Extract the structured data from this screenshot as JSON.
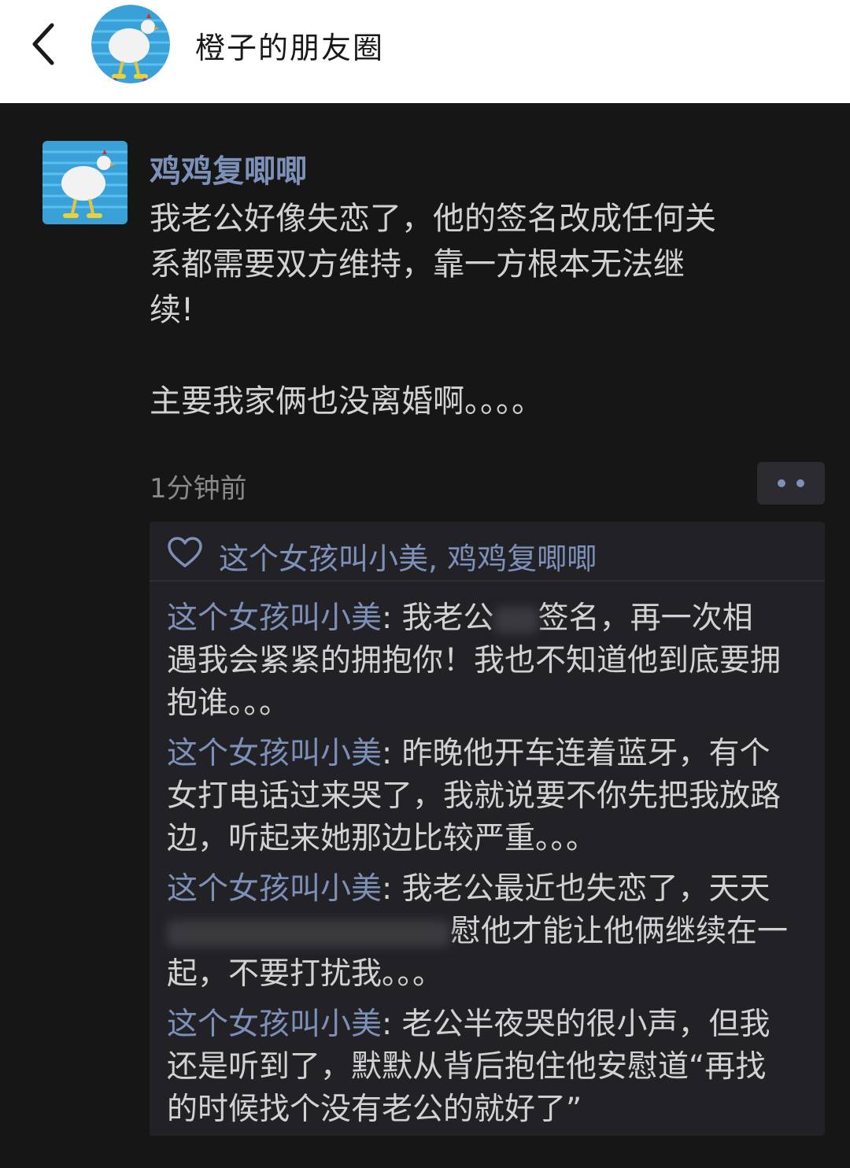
{
  "header": {
    "back_icon": "chevron-left-icon",
    "title": "橙子的朋友圈"
  },
  "post": {
    "author": "鸡鸡复唧唧",
    "text_lines": [
      "我老公好像失恋了，他的签名改成任何关",
      "系都需要双方维持，靠一方根本无法继",
      "续!",
      "主要我家俩也没离婚啊。。。。"
    ],
    "time": "1分钟前",
    "more_icon": "more-dots-icon"
  },
  "likes": {
    "heart_icon": "heart-outline-icon",
    "names": "这个女孩叫小美, 鸡鸡复唧唧"
  },
  "comments": [
    {
      "name": "这个女孩叫小美",
      "first": ": 我老公",
      "first_after_blur": "签名，再一次相",
      "lines": [
        "遇我会紧紧的拥抱你！我也不知道他到底要拥",
        "抱谁。。。"
      ]
    },
    {
      "name": "这个女孩叫小美",
      "first": ": 昨晚他开车连着蓝牙，有个",
      "lines": [
        "女打电话过来哭了，我就说要不你先把我放路",
        "边，听起来她那边比较严重。。。"
      ]
    },
    {
      "name": "这个女孩叫小美",
      "first": ": 我老公最近也失恋了，天天",
      "second_after_blur": "慰他才能让他俩继续在一",
      "lines": [
        "起，不要打扰我。。。"
      ]
    },
    {
      "name": "这个女孩叫小美",
      "first": ": 老公半夜哭的很小声，但我",
      "lines": [
        "还是听到了，默默从背后抱住他安慰道“再找",
        "的时候找个没有老公的就好了”"
      ]
    }
  ],
  "colors": {
    "name_link": "#7d90b8",
    "body_text": "#d2d2d2",
    "background": "#161616",
    "panel": "#222226"
  }
}
